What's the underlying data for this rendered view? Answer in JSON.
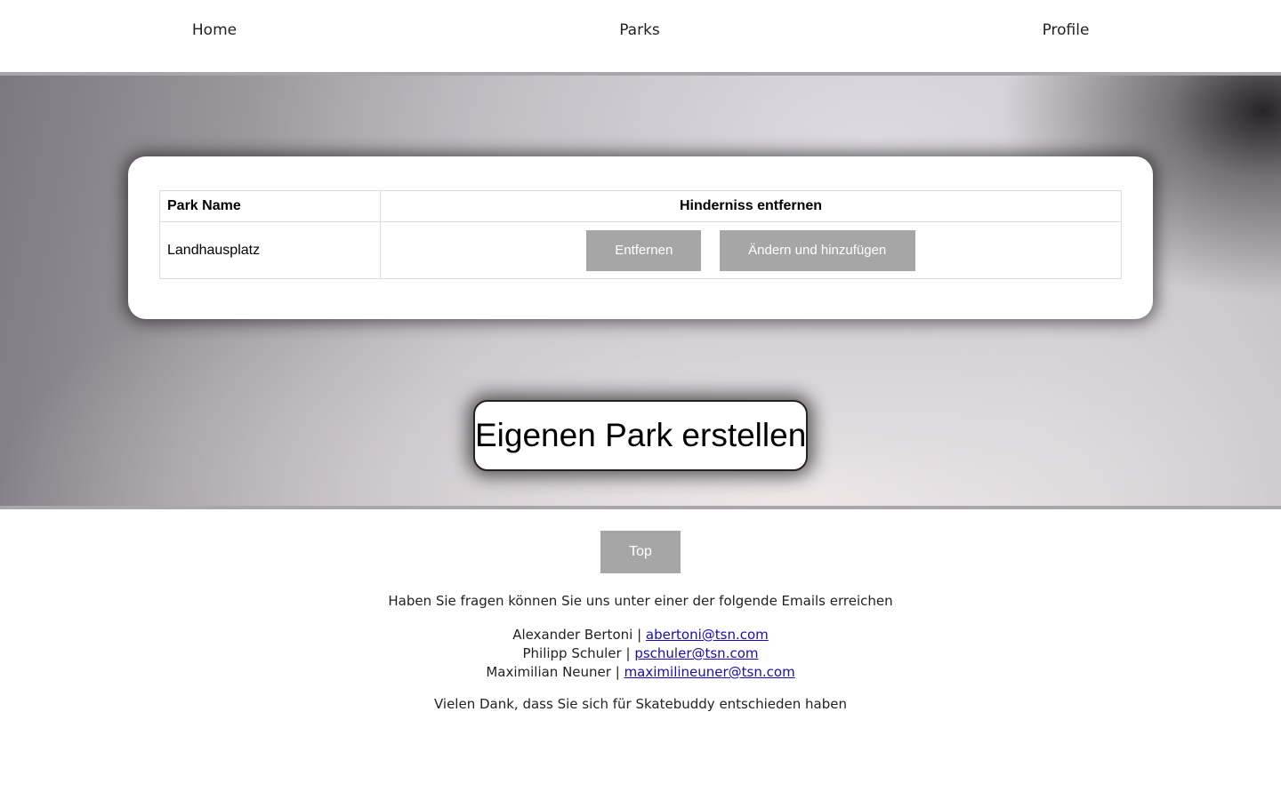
{
  "nav": {
    "items": [
      {
        "label": "Home"
      },
      {
        "label": "Parks"
      },
      {
        "label": "Profile"
      }
    ]
  },
  "parks_table": {
    "headers": {
      "name": "Park Name",
      "action": "Hinderniss entfernen"
    },
    "rows": [
      {
        "name": "Landhausplatz",
        "remove_label": "Entfernen",
        "edit_label": "Ändern und hinzufügen"
      }
    ]
  },
  "create_park_label": "Eigenen Park erstellen",
  "footer": {
    "top_label": "Top",
    "intro": "Haben Sie fragen können Sie uns unter einer der folgende Emails erreichen",
    "contacts": [
      {
        "name": "Alexander Bertoni",
        "separator": "|",
        "email": "abertoni@tsn.com"
      },
      {
        "name": "Philipp Schuler",
        "separator": "|",
        "email": "pschuler@tsn.com"
      },
      {
        "name": "Maximilian Neuner",
        "separator": "|",
        "email": "maximilineuner@tsn.com"
      }
    ],
    "thanks": "Vielen Dank, dass Sie sich für Skatebuddy entschieden haben"
  },
  "colors": {
    "button_grey": "#a6a6a6",
    "link": "#1a0dab",
    "divider": "#a9a7ab"
  }
}
